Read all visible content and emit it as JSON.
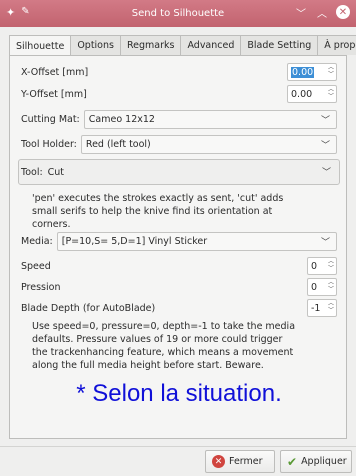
{
  "window": {
    "title": "Send to Silhouette"
  },
  "tabs": [
    "Silhouette",
    "Options",
    "Regmarks",
    "Advanced",
    "Blade Setting",
    "À propos"
  ],
  "fields": {
    "x_offset": {
      "label": "X-Offset [mm]",
      "value": "0.00"
    },
    "y_offset": {
      "label": "Y-Offset [mm]",
      "value": "0.00"
    },
    "cutting_mat": {
      "label": "Cutting Mat:",
      "value": "Cameo 12x12"
    },
    "tool_holder": {
      "label": "Tool Holder:",
      "value": "Red (left tool)"
    },
    "tool": {
      "label": "Tool:",
      "value": "Cut"
    },
    "tool_help": [
      "'pen' executes the strokes exactly as sent, 'cut' adds",
      "small serifs to help the knive find its orientation at",
      "corners."
    ],
    "media": {
      "label": "Media:",
      "value": "[P=10,S= 5,D=1] Vinyl Sticker"
    },
    "speed": {
      "label": "Speed",
      "value": "0"
    },
    "pression": {
      "label": "Pression",
      "value": "0"
    },
    "blade_depth": {
      "label": "Blade Depth (for AutoBlade)",
      "value": "-1"
    },
    "media_help": [
      "Use speed=0, pressure=0, depth=-1 to take the media",
      "defaults. Pressure values of 19 or more could trigger",
      "the trackenhancing feature, which means a movement",
      "along the full media height before start. Beware."
    ]
  },
  "annotation": "* Selon la situation.",
  "buttons": {
    "close": "Fermer",
    "apply": "Appliquer"
  },
  "colors": {
    "titlebar": "#c96c78",
    "annotation": "#1010d8",
    "selection": "#3d8fd6"
  }
}
